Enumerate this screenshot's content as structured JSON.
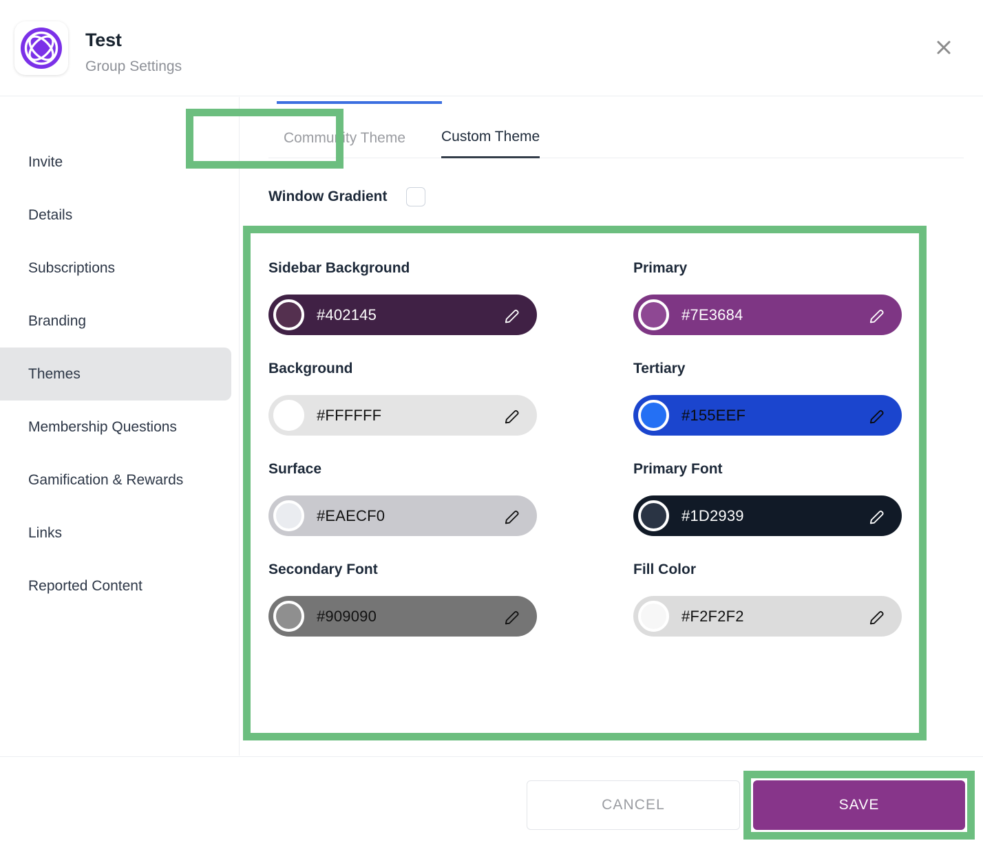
{
  "header": {
    "title": "Test",
    "subtitle": "Group Settings",
    "logo_icon": "atom-circle-logo-icon",
    "logo_color": "#7B31E8",
    "close_icon": "close-icon"
  },
  "sidebar": {
    "items": [
      {
        "label": "Invite",
        "active": false
      },
      {
        "label": "Details",
        "active": false
      },
      {
        "label": "Subscriptions",
        "active": false
      },
      {
        "label": "Branding",
        "active": false
      },
      {
        "label": "Themes",
        "active": true
      },
      {
        "label": "Membership Questions",
        "active": false
      },
      {
        "label": "Gamification & Rewards",
        "active": false
      },
      {
        "label": "Links",
        "active": false
      },
      {
        "label": "Reported Content",
        "active": false
      }
    ],
    "active_bg": "#E4E5E7"
  },
  "tabs": [
    {
      "label": "Community Theme",
      "selected": false
    },
    {
      "label": "Custom Theme",
      "selected": true
    }
  ],
  "window_gradient": {
    "label": "Window Gradient",
    "checked": false,
    "checkbox_icon": "checkbox-unchecked-icon"
  },
  "colors": [
    {
      "label": "Sidebar Background",
      "hex": "#402145",
      "pill_bg": "#402145",
      "dot": "#54304F",
      "ring": "#FFFFFF",
      "text_color": "#FFFFFF",
      "pencil_color": "#FFFFFF",
      "pencil_icon": "pencil-edit-icon"
    },
    {
      "label": "Primary",
      "hex": "#7E3684",
      "pill_bg": "#7E3684",
      "dot": "#8E4893",
      "ring": "#FFFFFF",
      "text_color": "#FFFFFF",
      "pencil_color": "#FFFFFF",
      "pencil_icon": "pencil-edit-icon"
    },
    {
      "label": "Background",
      "hex": "#FFFFFF",
      "pill_bg": "#E4E4E4",
      "dot": "#FFFFFF",
      "ring": "#FFFFFF",
      "text_color": "#111111",
      "pencil_color": "#111111",
      "pencil_icon": "pencil-edit-icon"
    },
    {
      "label": "Tertiary",
      "hex": "#155EEF",
      "pill_bg": "#1B45CE",
      "dot": "#2470F4",
      "ring": "#FFFFFF",
      "text_color": "#0A0A0A",
      "pencil_color": "#0A0A0A",
      "pencil_icon": "pencil-edit-icon"
    },
    {
      "label": "Surface",
      "hex": "#EAECF0",
      "pill_bg": "#C9C9CE",
      "dot": "#EAECF0",
      "ring": "#FFFFFF",
      "text_color": "#111111",
      "pencil_color": "#111111",
      "pencil_icon": "pencil-edit-icon"
    },
    {
      "label": "Primary Font",
      "hex": "#1D2939",
      "pill_bg": "#111A27",
      "dot": "#2A3444",
      "ring": "#FFFFFF",
      "text_color": "#FFFFFF",
      "pencil_color": "#FFFFFF",
      "pencil_icon": "pencil-edit-icon"
    },
    {
      "label": "Secondary Font",
      "hex": "#909090",
      "pill_bg": "#757575",
      "dot": "#8F8F8F",
      "ring": "#FFFFFF",
      "text_color": "#111111",
      "pencil_color": "#111111",
      "pencil_icon": "pencil-edit-icon"
    },
    {
      "label": "Fill Color",
      "hex": "#F2F2F2",
      "pill_bg": "#DCDCDC",
      "dot": "#F7F7F7",
      "ring": "#FFFFFF",
      "text_color": "#111111",
      "pencil_color": "#111111",
      "pencil_icon": "pencil-edit-icon"
    }
  ],
  "footer": {
    "cancel_label": "CANCEL",
    "save_label": "SAVE",
    "save_bg": "#87358A"
  },
  "annotations": {
    "highlight_color": "#6CBE7F",
    "targets": [
      "Custom Theme tab",
      "Color swatch panel",
      "SAVE button"
    ]
  }
}
